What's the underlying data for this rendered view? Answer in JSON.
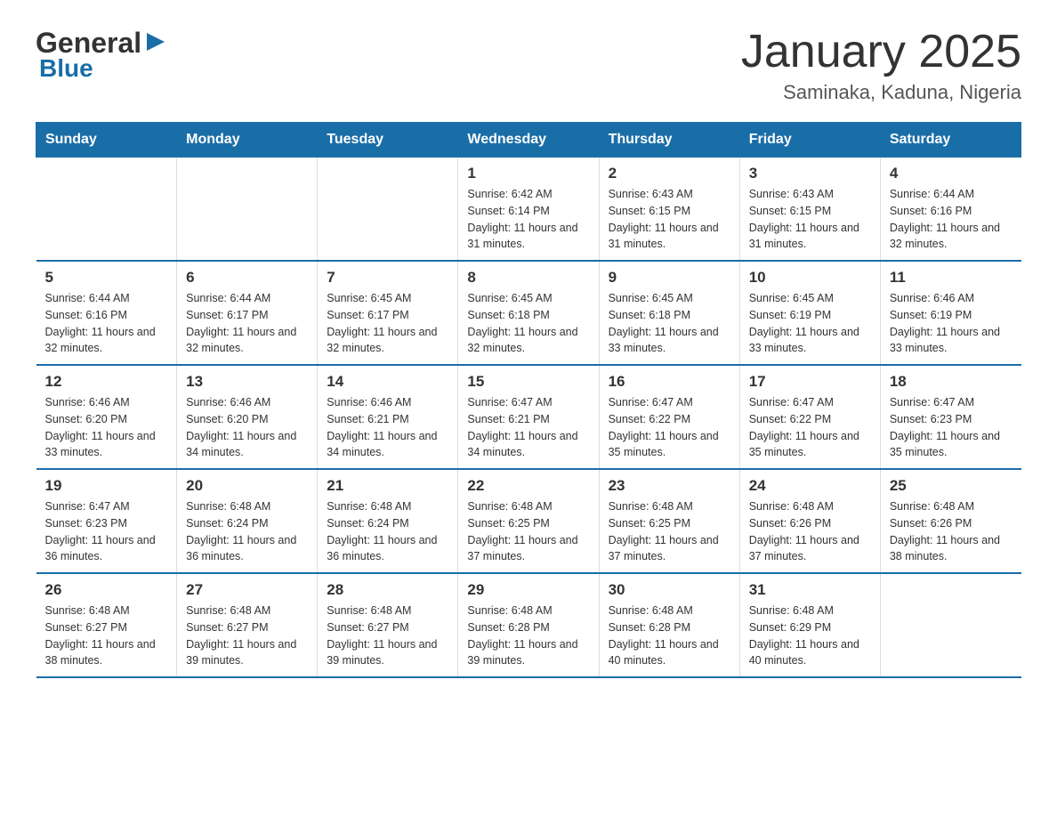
{
  "logo": {
    "general": "General",
    "triangle": "▶",
    "blue": "Blue"
  },
  "title": "January 2025",
  "subtitle": "Saminaka, Kaduna, Nigeria",
  "days_of_week": [
    "Sunday",
    "Monday",
    "Tuesday",
    "Wednesday",
    "Thursday",
    "Friday",
    "Saturday"
  ],
  "weeks": [
    [
      {
        "day": "",
        "info": ""
      },
      {
        "day": "",
        "info": ""
      },
      {
        "day": "",
        "info": ""
      },
      {
        "day": "1",
        "info": "Sunrise: 6:42 AM\nSunset: 6:14 PM\nDaylight: 11 hours and 31 minutes."
      },
      {
        "day": "2",
        "info": "Sunrise: 6:43 AM\nSunset: 6:15 PM\nDaylight: 11 hours and 31 minutes."
      },
      {
        "day": "3",
        "info": "Sunrise: 6:43 AM\nSunset: 6:15 PM\nDaylight: 11 hours and 31 minutes."
      },
      {
        "day": "4",
        "info": "Sunrise: 6:44 AM\nSunset: 6:16 PM\nDaylight: 11 hours and 32 minutes."
      }
    ],
    [
      {
        "day": "5",
        "info": "Sunrise: 6:44 AM\nSunset: 6:16 PM\nDaylight: 11 hours and 32 minutes."
      },
      {
        "day": "6",
        "info": "Sunrise: 6:44 AM\nSunset: 6:17 PM\nDaylight: 11 hours and 32 minutes."
      },
      {
        "day": "7",
        "info": "Sunrise: 6:45 AM\nSunset: 6:17 PM\nDaylight: 11 hours and 32 minutes."
      },
      {
        "day": "8",
        "info": "Sunrise: 6:45 AM\nSunset: 6:18 PM\nDaylight: 11 hours and 32 minutes."
      },
      {
        "day": "9",
        "info": "Sunrise: 6:45 AM\nSunset: 6:18 PM\nDaylight: 11 hours and 33 minutes."
      },
      {
        "day": "10",
        "info": "Sunrise: 6:45 AM\nSunset: 6:19 PM\nDaylight: 11 hours and 33 minutes."
      },
      {
        "day": "11",
        "info": "Sunrise: 6:46 AM\nSunset: 6:19 PM\nDaylight: 11 hours and 33 minutes."
      }
    ],
    [
      {
        "day": "12",
        "info": "Sunrise: 6:46 AM\nSunset: 6:20 PM\nDaylight: 11 hours and 33 minutes."
      },
      {
        "day": "13",
        "info": "Sunrise: 6:46 AM\nSunset: 6:20 PM\nDaylight: 11 hours and 34 minutes."
      },
      {
        "day": "14",
        "info": "Sunrise: 6:46 AM\nSunset: 6:21 PM\nDaylight: 11 hours and 34 minutes."
      },
      {
        "day": "15",
        "info": "Sunrise: 6:47 AM\nSunset: 6:21 PM\nDaylight: 11 hours and 34 minutes."
      },
      {
        "day": "16",
        "info": "Sunrise: 6:47 AM\nSunset: 6:22 PM\nDaylight: 11 hours and 35 minutes."
      },
      {
        "day": "17",
        "info": "Sunrise: 6:47 AM\nSunset: 6:22 PM\nDaylight: 11 hours and 35 minutes."
      },
      {
        "day": "18",
        "info": "Sunrise: 6:47 AM\nSunset: 6:23 PM\nDaylight: 11 hours and 35 minutes."
      }
    ],
    [
      {
        "day": "19",
        "info": "Sunrise: 6:47 AM\nSunset: 6:23 PM\nDaylight: 11 hours and 36 minutes."
      },
      {
        "day": "20",
        "info": "Sunrise: 6:48 AM\nSunset: 6:24 PM\nDaylight: 11 hours and 36 minutes."
      },
      {
        "day": "21",
        "info": "Sunrise: 6:48 AM\nSunset: 6:24 PM\nDaylight: 11 hours and 36 minutes."
      },
      {
        "day": "22",
        "info": "Sunrise: 6:48 AM\nSunset: 6:25 PM\nDaylight: 11 hours and 37 minutes."
      },
      {
        "day": "23",
        "info": "Sunrise: 6:48 AM\nSunset: 6:25 PM\nDaylight: 11 hours and 37 minutes."
      },
      {
        "day": "24",
        "info": "Sunrise: 6:48 AM\nSunset: 6:26 PM\nDaylight: 11 hours and 37 minutes."
      },
      {
        "day": "25",
        "info": "Sunrise: 6:48 AM\nSunset: 6:26 PM\nDaylight: 11 hours and 38 minutes."
      }
    ],
    [
      {
        "day": "26",
        "info": "Sunrise: 6:48 AM\nSunset: 6:27 PM\nDaylight: 11 hours and 38 minutes."
      },
      {
        "day": "27",
        "info": "Sunrise: 6:48 AM\nSunset: 6:27 PM\nDaylight: 11 hours and 39 minutes."
      },
      {
        "day": "28",
        "info": "Sunrise: 6:48 AM\nSunset: 6:27 PM\nDaylight: 11 hours and 39 minutes."
      },
      {
        "day": "29",
        "info": "Sunrise: 6:48 AM\nSunset: 6:28 PM\nDaylight: 11 hours and 39 minutes."
      },
      {
        "day": "30",
        "info": "Sunrise: 6:48 AM\nSunset: 6:28 PM\nDaylight: 11 hours and 40 minutes."
      },
      {
        "day": "31",
        "info": "Sunrise: 6:48 AM\nSunset: 6:29 PM\nDaylight: 11 hours and 40 minutes."
      },
      {
        "day": "",
        "info": ""
      }
    ]
  ]
}
